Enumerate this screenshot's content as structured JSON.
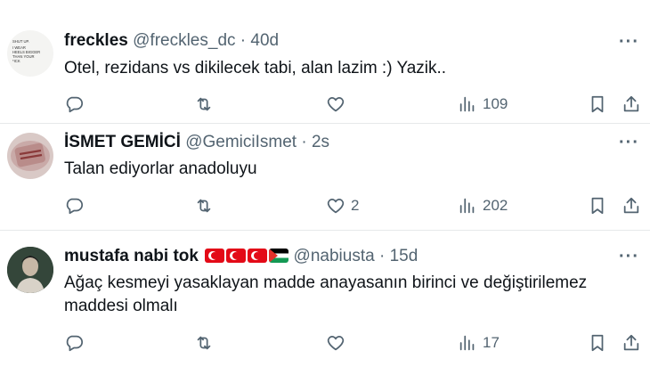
{
  "tweets": [
    {
      "name": "freckles",
      "handle": "@freckles_dc",
      "separator": "·",
      "time": "40d",
      "flags": [],
      "text": "Otel, rezidans vs dikilecek tabi, alan lazim :) Yazik..",
      "reply_count": "",
      "retweet_count": "",
      "like_count": "",
      "views": "109",
      "avatar_text": "SHUT UP. I WEAR HEELS BIGGER THAN YOUR *ICK",
      "more": "···"
    },
    {
      "name": "İSMET GEMİCİ",
      "handle": "@GemiciIsmet",
      "separator": "·",
      "time": "2s",
      "flags": [],
      "text": "Talan ediyorlar anadoluyu",
      "reply_count": "",
      "retweet_count": "",
      "like_count": "2",
      "views": "202",
      "more": "···"
    },
    {
      "name": "mustafa nabi tok",
      "handle": "@nabiusta",
      "separator": "·",
      "time": "15d",
      "flags": [
        "turkey-flag",
        "turkey-flag",
        "turkey-flag",
        "palestine-flag"
      ],
      "text": "Ağaç kesmeyi yasaklayan madde anayasanın birinci ve değiştirilemez maddesi olmalı",
      "reply_count": "",
      "retweet_count": "",
      "like_count": "",
      "views": "17",
      "more": "···"
    }
  ],
  "icons": {
    "reply": "reply-icon",
    "retweet": "retweet-icon",
    "like": "like-icon",
    "views": "views-icon",
    "bookmark": "bookmark-icon",
    "share": "share-icon"
  },
  "colors": {
    "text": "#0f1419",
    "secondary": "#536471",
    "divider": "#e7e9ea",
    "flag_red": "#e30a17"
  }
}
